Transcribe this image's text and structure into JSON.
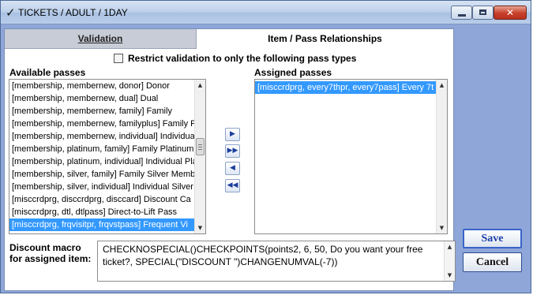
{
  "window": {
    "title": "TICKETS / ADULT / 1DAY",
    "title_check": "✓",
    "close_glyph": "✕"
  },
  "tabs": [
    {
      "label": "Validation",
      "active": false
    },
    {
      "label": "Item / Pass Relationships",
      "active": true
    }
  ],
  "restrict_checkbox": {
    "label": "Restrict validation to only the following pass types",
    "checked": false
  },
  "available": {
    "label": "Available passes",
    "items": [
      "[membership, membernew, donor] Donor",
      "[membership, membernew, dual] Dual",
      "[membership, membernew, family] Family",
      "[membership, membernew, familyplus] Family Pl",
      "[membership, membernew, individual] Individual",
      "[membership, platinum, family] Family Platinum M",
      "[membership, platinum, individual] Individual Plati",
      "[membership, silver, family] Family Silver Membe",
      "[membership, silver, individual] Individual Silver I",
      "[misccrdprg, disccrdprg, disccard] Discount Ca",
      "[misccrdprg, dtl, dtlpass] Direct-to-Lift Pass",
      "[misccrdprg, frqvisitpr, frqvstpass] Frequent Vi"
    ],
    "selected_index": 11
  },
  "assigned": {
    "label": "Assigned passes",
    "items": [
      "[misccrdprg, every7thpr, every7pass] Every 7t"
    ],
    "selected_index": 0
  },
  "move_buttons": [
    {
      "name": "move-right-button",
      "glyph": "▶"
    },
    {
      "name": "move-all-right-button",
      "glyph": "▶▶"
    },
    {
      "name": "move-left-button",
      "glyph": "◀"
    },
    {
      "name": "move-all-left-button",
      "glyph": "◀◀"
    }
  ],
  "scroll_glyphs": {
    "up": "▲",
    "down": "▼"
  },
  "macro": {
    "label_line1": "Discount macro",
    "label_line2": "for assigned item:",
    "value": "CHECKNOSPECIAL()CHECKPOINTS(points2, 6, 50, Do you want your free ticket?, SPECIAL(\"DISCOUNT  \")CHANGENUMVAL(-7))"
  },
  "actions": {
    "save_label": "Save",
    "cancel_label": "Cancel"
  },
  "colors": {
    "selection": "#3399ff",
    "window_background": "#8fa6d9",
    "save_text": "#1a3fa8"
  }
}
